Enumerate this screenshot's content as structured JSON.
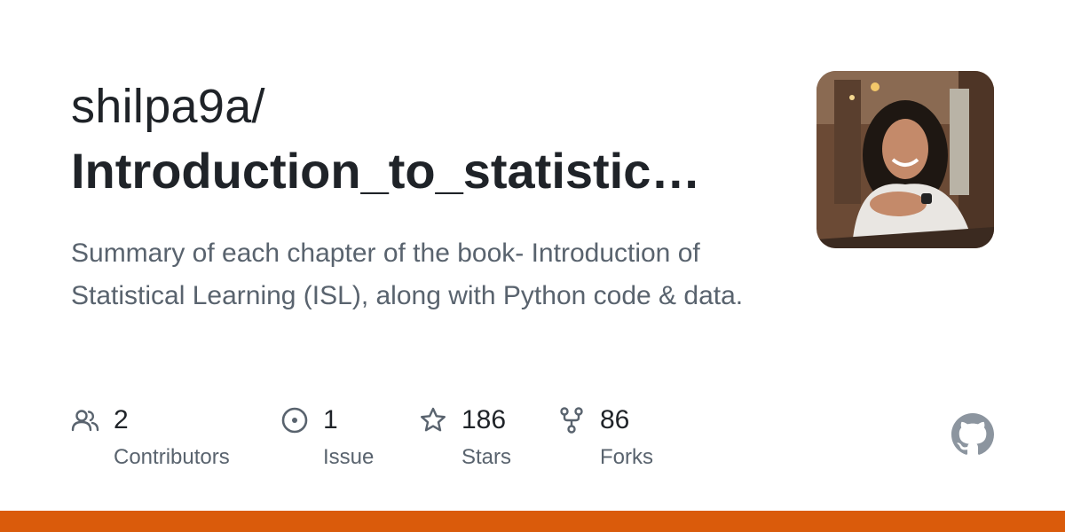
{
  "repo": {
    "owner": "shilpa9a/",
    "name": "Introduction_to_statistic…",
    "description": "Summary of each chapter of the book- Introduction of Statistical Learning (ISL), along with Python code & data."
  },
  "stats": [
    {
      "icon": "people-icon",
      "value": "2",
      "label": "Contributors"
    },
    {
      "icon": "issue-icon",
      "value": "1",
      "label": "Issue"
    },
    {
      "icon": "star-icon",
      "value": "186",
      "label": "Stars"
    },
    {
      "icon": "fork-icon",
      "value": "86",
      "label": "Forks"
    }
  ],
  "colors": {
    "text_primary": "#1f2328",
    "text_secondary": "#59636e",
    "icon": "#59636e",
    "language_bar": "#da5b0b",
    "github_logo": "#8c959f"
  }
}
